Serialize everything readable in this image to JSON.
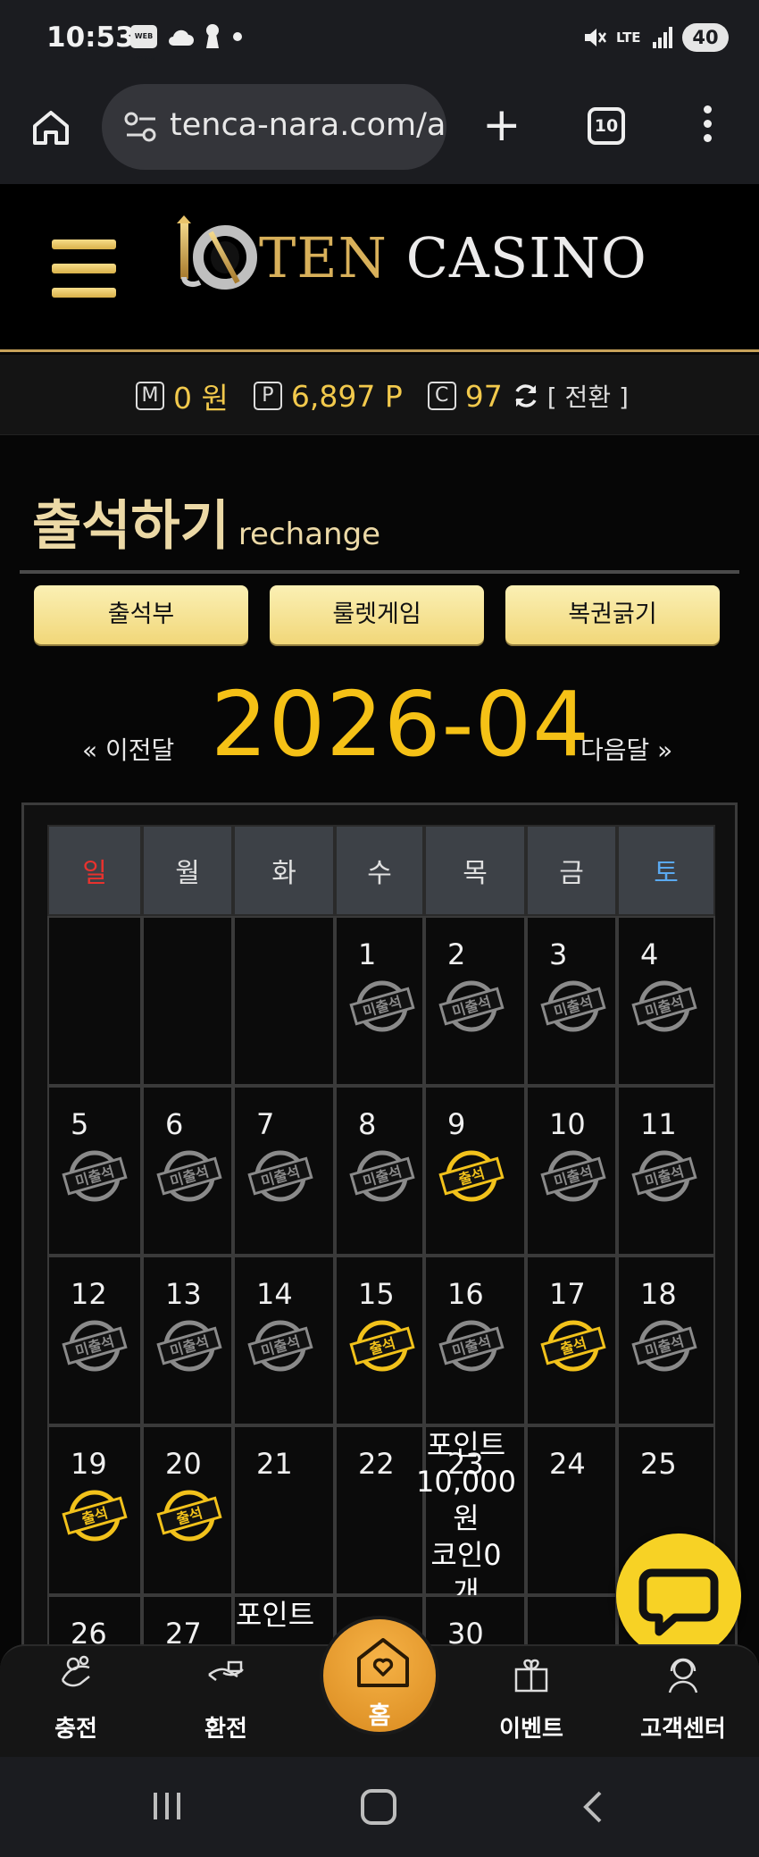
{
  "status_bar": {
    "time": "10:53",
    "webtoon_chip": "WEB TOON",
    "icons": [
      "webtoon-icon",
      "cloud-icon",
      "keyhole-icon",
      "dot-icon",
      "mute-icon",
      "lte-icon",
      "signal-icon"
    ],
    "lte": "LTE",
    "battery": "40"
  },
  "browser": {
    "url": "tenca-nara.com/a",
    "tab_count": "10"
  },
  "site": {
    "logo_ten": "TEN",
    "logo_casino": "CASINO"
  },
  "balance": {
    "money_letter": "M",
    "money_value": "0 원",
    "point_letter": "P",
    "point_value": "6,897 P",
    "coin_letter": "C",
    "coin_value": "97",
    "switch_label": "[ 전환 ]"
  },
  "attendance": {
    "title": "출석하기",
    "subtitle": "rechange",
    "tabs": [
      "출석부",
      "룰렛게임",
      "복권긁기"
    ],
    "prev_label": "« 이전달",
    "month": "2026-04",
    "next_label": "다음달 »",
    "weekdays": [
      "일",
      "월",
      "화",
      "수",
      "목",
      "금",
      "토"
    ],
    "weekday_colors": {
      "sun": "#e8322e",
      "sat": "#5aa9f0",
      "other": "#e0e0e0"
    },
    "stamp_colors": {
      "absent": "#8a8a8a",
      "present": "#f2c21b"
    },
    "weeks": [
      [
        {
          "day": ""
        },
        {
          "day": ""
        },
        {
          "day": ""
        },
        {
          "day": "1",
          "stamp": "미출석"
        },
        {
          "day": "2",
          "stamp": "미출석"
        },
        {
          "day": "3",
          "stamp": "미출석"
        },
        {
          "day": "4",
          "stamp": "미출석"
        }
      ],
      [
        {
          "day": "5",
          "stamp": "미출석"
        },
        {
          "day": "6",
          "stamp": "미출석"
        },
        {
          "day": "7",
          "stamp": "미출석"
        },
        {
          "day": "8",
          "stamp": "미출석"
        },
        {
          "day": "9",
          "stamp": "출석"
        },
        {
          "day": "10",
          "stamp": "미출석"
        },
        {
          "day": "11",
          "stamp": "미출석"
        }
      ],
      [
        {
          "day": "12",
          "stamp": "미출석"
        },
        {
          "day": "13",
          "stamp": "미출석"
        },
        {
          "day": "14",
          "stamp": "미출석"
        },
        {
          "day": "15",
          "stamp": "출석"
        },
        {
          "day": "16",
          "stamp": "미출석"
        },
        {
          "day": "17",
          "stamp": "출석"
        },
        {
          "day": "18",
          "stamp": "미출석"
        }
      ],
      [
        {
          "day": "19",
          "stamp": "출석"
        },
        {
          "day": "20",
          "stamp": "출석"
        },
        {
          "day": "21"
        },
        {
          "day": "22"
        },
        {
          "day": "23",
          "note": [
            "포인트",
            "10,000",
            "원",
            "코인0",
            "개"
          ]
        },
        {
          "day": "24"
        },
        {
          "day": "25"
        }
      ],
      [
        {
          "day": "26"
        },
        {
          "day": "27"
        },
        {
          "day": "",
          "note": [
            "포인트"
          ]
        },
        {
          "day": ""
        },
        {
          "day": "30"
        },
        {
          "day": ""
        },
        {
          "day": ""
        }
      ]
    ]
  },
  "bottom_nav": {
    "charge": "충전",
    "exchange": "환전",
    "home": "홈",
    "event": "이벤트",
    "support": "고객센터"
  }
}
